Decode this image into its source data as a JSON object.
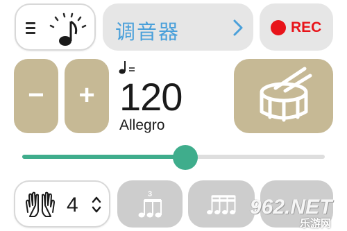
{
  "header": {
    "title": "调音器",
    "rec_label": "REC",
    "icons": {
      "menu": "hamburger-icon",
      "metronome": "metronome-icon",
      "arrow": "chevron-right-icon",
      "rec": "record-dot-icon"
    }
  },
  "tempo": {
    "minus_label": "−",
    "plus_label": "+",
    "note_symbol": "quarter-note-equals-icon",
    "bpm": "120",
    "name": "Allegro",
    "slider_position": 0.54,
    "drum_icon": "snare-drum-icon"
  },
  "beats": {
    "value": "4",
    "icons": {
      "hands": "clapping-hands-icon",
      "stepper": "up-down-stepper-icon"
    }
  },
  "patterns": [
    {
      "icon": "triplet-notes-icon",
      "number": "3"
    },
    {
      "icon": "sixteenth-notes-icon"
    },
    {
      "icon": "more-patterns-icon"
    }
  ],
  "watermark": {
    "text": "962.NET",
    "sub": "乐游网"
  },
  "colors": {
    "accent_tan": "#c6b995",
    "slider_green": "#3fad8c",
    "title_blue": "#4aa0da",
    "rec_red": "#e8141a",
    "button_grey": "#e6e6e6",
    "pattern_grey": "#cdcdcd"
  }
}
